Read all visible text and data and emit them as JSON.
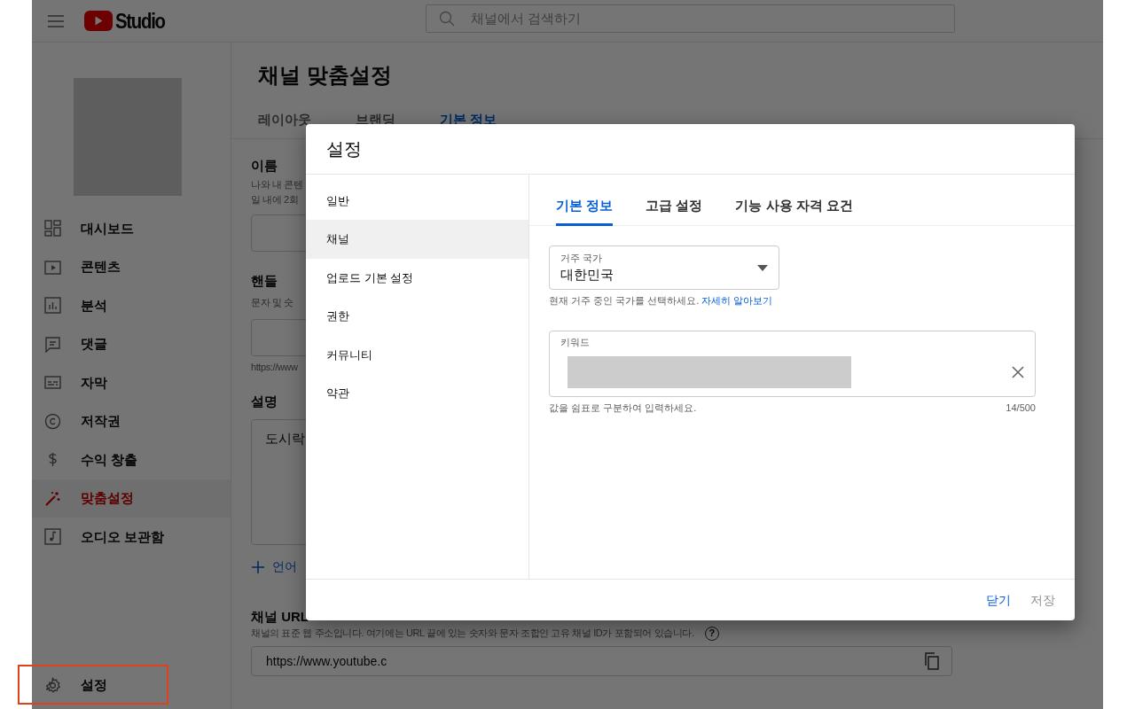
{
  "header": {
    "logo_text": "Studio",
    "search": {
      "placeholder": "채널에서 검색하기"
    }
  },
  "sidebar": {
    "items": [
      {
        "label": "대시보드",
        "kind": "dashboard",
        "selected": false
      },
      {
        "label": "콘텐츠",
        "kind": "content",
        "selected": false
      },
      {
        "label": "분석",
        "kind": "analytics",
        "selected": false
      },
      {
        "label": "댓글",
        "kind": "comments",
        "selected": false
      },
      {
        "label": "자막",
        "kind": "subtitles",
        "selected": false
      },
      {
        "label": "저작권",
        "kind": "copyright",
        "selected": false
      },
      {
        "label": "수익 창출",
        "kind": "money",
        "selected": false
      },
      {
        "label": "맞춤설정",
        "kind": "wand",
        "selected": true
      },
      {
        "label": "오디오 보관함",
        "kind": "audio",
        "selected": false
      }
    ],
    "footer_item": {
      "label": "설정",
      "kind": "settings",
      "highlighted": true
    }
  },
  "page": {
    "title": "채널 맞춤설정",
    "tabs": [
      {
        "label": "레이아웃",
        "selected": false
      },
      {
        "label": "브랜딩",
        "selected": false
      },
      {
        "label": "기본 정보",
        "selected": true
      }
    ],
    "name": {
      "heading": "이름",
      "helper_lines": [
        "나와 내 콘텐",
        "일 내에 2회"
      ]
    },
    "handle": {
      "heading": "핸들",
      "helper": "문자 및 숫",
      "url": "https://www"
    },
    "description": {
      "heading": "설명",
      "value": "도시락"
    },
    "add_language": {
      "label": "언어"
    },
    "channel_url": {
      "heading": "채널 URL",
      "helper": "채널의 표준 웹 주소입니다. 여기에는 URL 끝에 있는 숫자와 문자 조합인 고유 채널 ID가 포함되어 있습니다.",
      "help_icon": "?",
      "value": "https://www.youtube.c"
    }
  },
  "dialog": {
    "title": "설정",
    "nav": [
      {
        "label": "일반",
        "selected": false
      },
      {
        "label": "채널",
        "selected": true
      },
      {
        "label": "업로드 기본 설정",
        "selected": false
      },
      {
        "label": "권한",
        "selected": false
      },
      {
        "label": "커뮤니티",
        "selected": false
      },
      {
        "label": "약관",
        "selected": false
      }
    ],
    "tabs": [
      {
        "label": "기본 정보",
        "selected": true
      },
      {
        "label": "고급 설정",
        "selected": false
      },
      {
        "label": "기능 사용 자격 요건",
        "selected": false
      }
    ],
    "country": {
      "label": "거주 국가",
      "value": "대한민국",
      "helper": "현재 거주 중인 국가를 선택하세요.",
      "link": "자세히 알아보기"
    },
    "keywords": {
      "label": "키워드",
      "helper": "값을 쉼표로 구분하여 입력하세요.",
      "count": "14/500"
    },
    "buttons": [
      {
        "label": "닫기",
        "disabled": false
      },
      {
        "label": "저장",
        "disabled": true
      }
    ]
  }
}
